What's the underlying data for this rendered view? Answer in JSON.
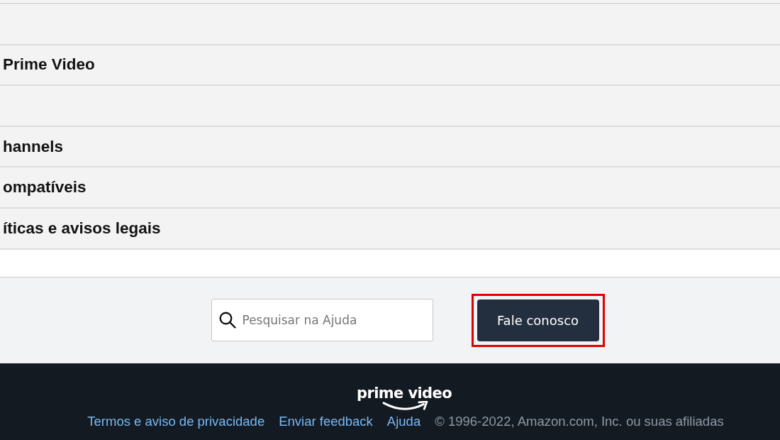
{
  "accordion": {
    "rows": [
      {
        "kind": "blank"
      },
      {
        "kind": "titled",
        "title": "Prime Video"
      },
      {
        "kind": "blank"
      },
      {
        "kind": "titled",
        "title": "hannels"
      },
      {
        "kind": "titled",
        "title": "ompatíveis"
      },
      {
        "kind": "titled",
        "title": "íticas e avisos legais"
      }
    ]
  },
  "help_bar": {
    "search": {
      "placeholder": "Pesquisar na Ajuda"
    },
    "contact_button": {
      "label": "Fale conosco",
      "highlighted": true
    }
  },
  "footer": {
    "logo_text": "prime video",
    "links": [
      "Termos e aviso de privacidade",
      "Enviar feedback",
      "Ajuda"
    ],
    "copyright": "© 1996-2022, Amazon.com, Inc. ou suas afiliadas"
  }
}
